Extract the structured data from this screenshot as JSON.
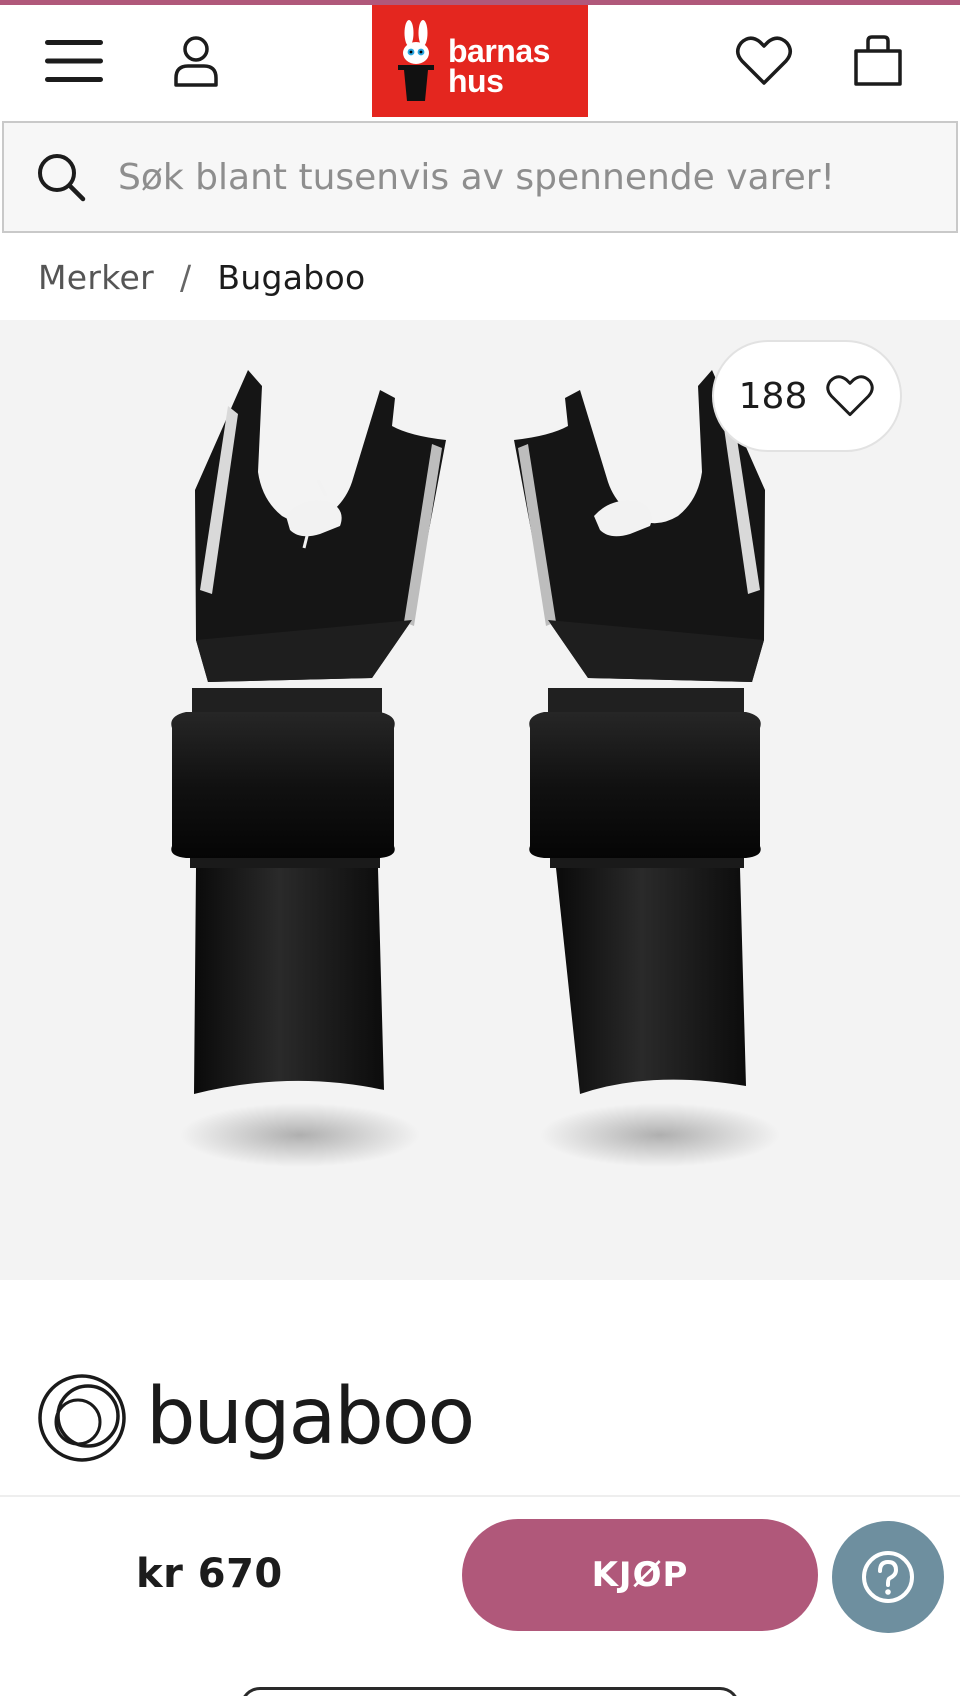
{
  "header": {
    "logo": {
      "line1": "barnas",
      "line2": "hus"
    },
    "icons": {
      "menu": "menu-icon",
      "account": "user-icon",
      "wishlist": "heart-icon",
      "cart": "shopping-bag-icon"
    }
  },
  "search": {
    "placeholder": "Søk blant tusenvis av spennende varer!",
    "icon": "search-icon"
  },
  "breadcrumb": {
    "items": [
      "Merker",
      "Bugaboo"
    ],
    "separator": "/"
  },
  "gallery": {
    "favorite_count": "188",
    "favorite_icon": "heart-icon"
  },
  "brand": {
    "name": "bugaboo"
  },
  "purchase": {
    "price": "kr 670",
    "buy_label": "KJØP",
    "help_icon": "question-icon"
  },
  "colors": {
    "accent": "#b0587a",
    "logo_red": "#e4261f",
    "help_blue": "#6e8f9f"
  }
}
